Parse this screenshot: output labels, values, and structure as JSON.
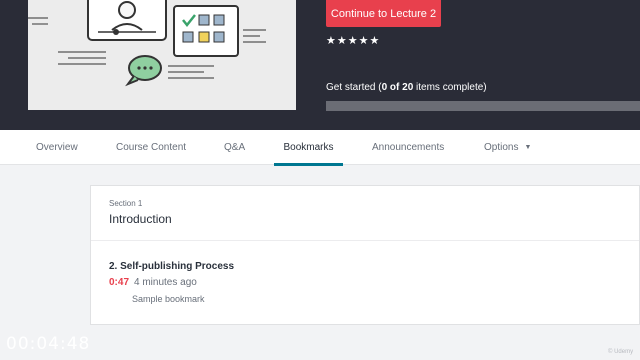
{
  "hero": {
    "continue_button": "Continue to Lecture 2",
    "rating_stars": "★★★★★",
    "rating": 5,
    "progress": {
      "prefix": "Get started (",
      "completed": "0",
      "of": " of ",
      "total": "20",
      "suffix": " items complete)",
      "fraction": 0
    }
  },
  "tabs": [
    {
      "label": "Overview",
      "active": false
    },
    {
      "label": "Course Content",
      "active": false
    },
    {
      "label": "Q&A",
      "active": false
    },
    {
      "label": "Bookmarks",
      "active": true
    },
    {
      "label": "Announcements",
      "active": false
    },
    {
      "label": "Options",
      "active": false,
      "dropdown": true
    }
  ],
  "bookmarks": {
    "section_label": "Section 1",
    "section_title": "Introduction",
    "lecture_title": "2. Self-publishing Process",
    "time": "0:47",
    "ago": "4 minutes ago",
    "note": "Sample bookmark"
  },
  "timer": "00:04:48",
  "watermark": "© Udemy",
  "colors": {
    "hero_bg": "#2a2c37",
    "accent_red": "#e8404d",
    "tab_underline": "#007791"
  }
}
